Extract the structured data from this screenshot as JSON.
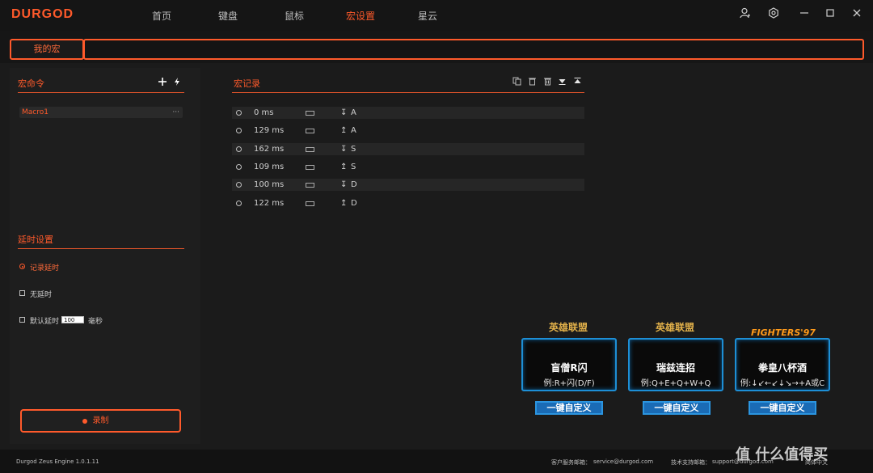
{
  "app": {
    "logo": "DURGOD"
  },
  "nav": [
    {
      "label": "首页",
      "active": false
    },
    {
      "label": "键盘",
      "active": false
    },
    {
      "label": "鼠标",
      "active": false
    },
    {
      "label": "宏设置",
      "active": true
    },
    {
      "label": "星云",
      "active": false
    }
  ],
  "window_controls": [
    "user-icon",
    "settings-icon",
    "minimize-icon",
    "maximize-icon",
    "close-icon"
  ],
  "subbar": {
    "my_macro_tab": "我的宏",
    "search_value": ""
  },
  "macro_commands": {
    "title": "宏命令",
    "items": [
      {
        "name": "Macro1",
        "more": "···"
      }
    ]
  },
  "delay_settings": {
    "title": "延时设置",
    "options": [
      {
        "label": "记录延时",
        "type": "radio",
        "selected": true
      },
      {
        "label": "无延时",
        "type": "checkbox",
        "selected": false
      },
      {
        "label": "默认延时",
        "type": "checkbox",
        "selected": false,
        "value": "100",
        "unit": "毫秒"
      }
    ]
  },
  "record_button": "录制",
  "macro_record": {
    "title": "宏记录",
    "rows": [
      {
        "delay": "0 ms",
        "direction": "↧",
        "key": "A"
      },
      {
        "delay": "129 ms",
        "direction": "↥",
        "key": "A"
      },
      {
        "delay": "162 ms",
        "direction": "↧",
        "key": "S"
      },
      {
        "delay": "109 ms",
        "direction": "↥",
        "key": "S"
      },
      {
        "delay": "100 ms",
        "direction": "↧",
        "key": "D"
      },
      {
        "delay": "122 ms",
        "direction": "↥",
        "key": "D"
      }
    ]
  },
  "promos": [
    {
      "badge": "英雄联盟",
      "title": "盲僧R闪",
      "example": "例:R+闪(D/F)",
      "button": "一键自定义"
    },
    {
      "badge": "英雄联盟",
      "title": "瑞兹连招",
      "example": "例:Q+E+Q+W+Q",
      "button": "一键自定义"
    },
    {
      "badge": "FIGHTERS'97",
      "title": "拳皇八杯酒",
      "example": "例:↓↙←↙↓↘→+A或C",
      "button": "一键自定义"
    }
  ],
  "footer": {
    "version": "Durgod Zeus Engine 1.0.1.11",
    "customer_service_label": "客户服务邮箱：",
    "customer_service_email": "service@durgod.com",
    "tech_support_label": "技术支持邮箱：",
    "tech_support_email": "support@durgod.com",
    "language": "简体中文",
    "watermark": "值 什么值得买"
  },
  "colors": {
    "accent": "#ff5a2b",
    "promo_blue": "#1d8fd6"
  }
}
